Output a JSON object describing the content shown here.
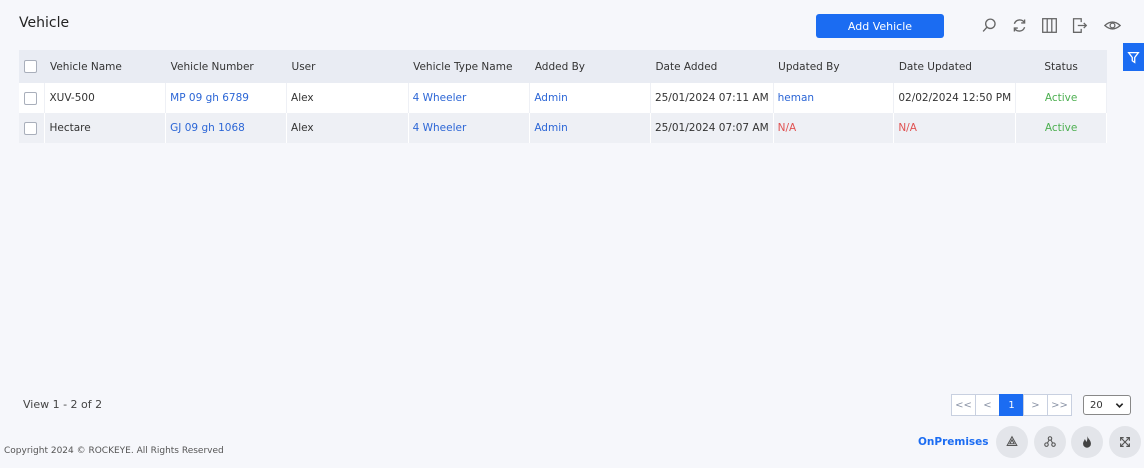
{
  "page": {
    "title": "Vehicle",
    "add_button_label": "Add Vehicle"
  },
  "toolbar": {
    "icons": [
      "search-icon",
      "refresh-icon",
      "columns-icon",
      "export-icon",
      "view-icon"
    ]
  },
  "table": {
    "columns": [
      "Vehicle Name",
      "Vehicle Number",
      "User",
      "Vehicle Type Name",
      "Added By",
      "Date Added",
      "Updated By",
      "Date Updated",
      "Status"
    ],
    "rows": [
      {
        "vehicle_name": "XUV-500",
        "vehicle_number": "MP 09 gh 6789",
        "user": "Alex",
        "vehicle_type": "4 Wheeler",
        "added_by": "Admin",
        "date_added": "25/01/2024 07:11 AM",
        "updated_by": "heman",
        "date_updated": "02/02/2024 12:50 PM",
        "status": "Active"
      },
      {
        "vehicle_name": "Hectare",
        "vehicle_number": "GJ 09 gh 1068",
        "user": "Alex",
        "vehicle_type": "4 Wheeler",
        "added_by": "Admin",
        "date_added": "25/01/2024 07:07 AM",
        "updated_by": "N/A",
        "date_updated": "N/A",
        "status": "Active"
      }
    ]
  },
  "footer": {
    "view_text": "View 1 - 2 of 2",
    "pager": {
      "first": "<<",
      "prev": "<",
      "current": "1",
      "next": ">",
      "last": ">>"
    },
    "page_size": "20",
    "copyright": "Copyright 2024 © ROCKEYE. All Rights Reserved",
    "deployment": "OnPremises"
  },
  "colors": {
    "accent": "#1b6cf2",
    "link": "#2c66d6",
    "na": "#e05252",
    "active": "#4caf50"
  }
}
